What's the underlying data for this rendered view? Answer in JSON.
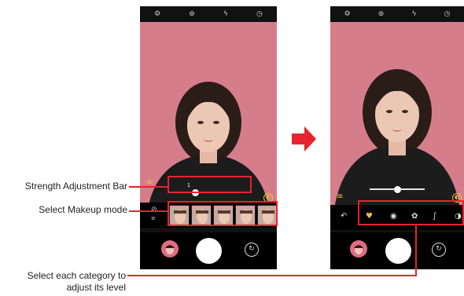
{
  "callouts": {
    "strength_bar": "Strength Adjustment Bar",
    "makeup_mode": "Select Makeup mode",
    "category_line1": "Select each category to",
    "category_line2": "adjust its level"
  },
  "colors": {
    "highlight": "#e6232e",
    "backdrop": "#d67d8b",
    "accent": "#e8c33a",
    "ui_dark": "#111111"
  },
  "before_screen": {
    "top_icons": [
      "settings-icon",
      "filter-icon",
      "flash-off-icon",
      "timer-icon"
    ],
    "strength_level": 0.2,
    "strength_value_label": "1",
    "makeup_thumbnails": 5,
    "category_icons": []
  },
  "after_screen": {
    "top_icons": [
      "settings-icon",
      "filter-icon",
      "flash-off-icon",
      "timer-icon"
    ],
    "strength_level": 0.5,
    "category_icons": [
      "back-icon",
      "lipstick-icon",
      "eye-icon",
      "cheek-icon",
      "brush-icon",
      "contour-icon"
    ]
  }
}
